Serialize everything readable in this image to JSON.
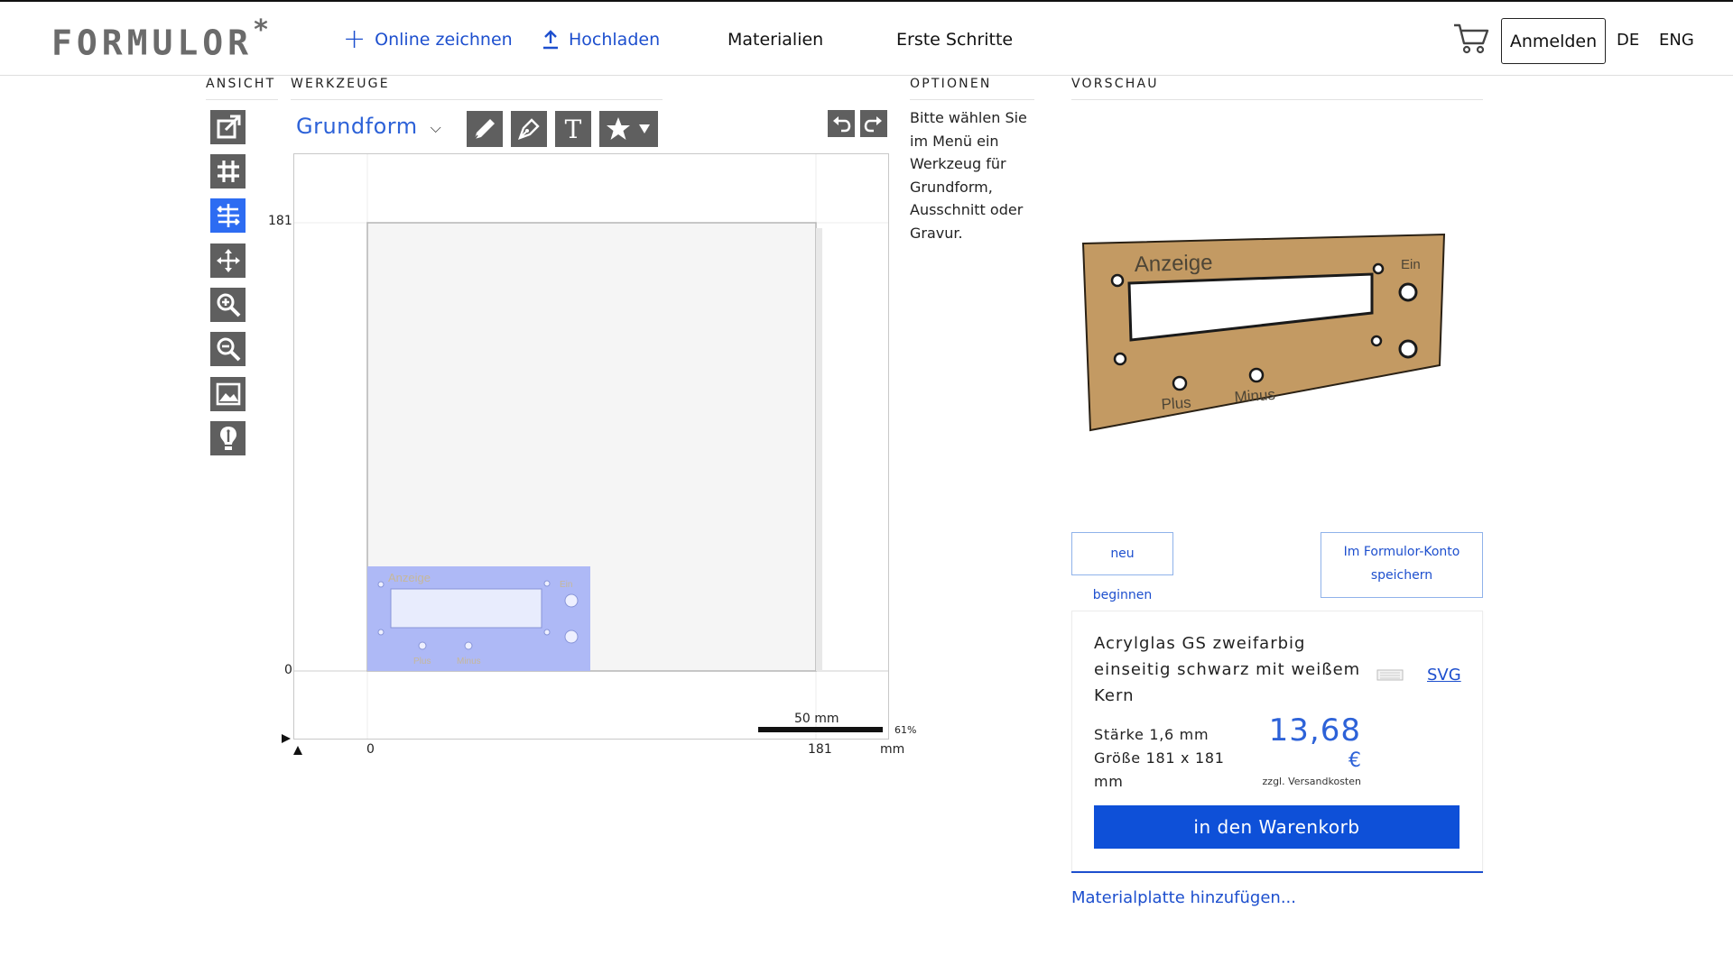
{
  "header": {
    "logo": "FORMULOR",
    "logo_mark": "*",
    "nav_online": "Online zeichnen",
    "nav_upload": "Hochladen",
    "nav_materials": "Materialien",
    "nav_first_steps": "Erste Schritte",
    "login": "Anmelden",
    "lang_de": "DE",
    "lang_en": "ENG"
  },
  "sections": {
    "view": "ANSICHT",
    "tools": "WERKZEUGE",
    "options": "OPTIONEN",
    "preview": "VORSCHAU"
  },
  "view_tools": [
    {
      "icon": "export-icon",
      "active": false
    },
    {
      "icon": "grid-icon",
      "active": false
    },
    {
      "icon": "align-icon",
      "active": true
    },
    {
      "icon": "move-icon",
      "active": false
    },
    {
      "icon": "zoom-in-icon",
      "active": false
    },
    {
      "icon": "zoom-out-icon",
      "active": false
    },
    {
      "icon": "image-icon",
      "active": false
    },
    {
      "icon": "hint-icon",
      "active": false
    }
  ],
  "tools": {
    "shape_select": "Grundform",
    "tool_icons": [
      "pencil-icon",
      "pen-icon",
      "text-icon",
      "star-icon"
    ],
    "text_tool_glyph": "T",
    "undo_icon": "undo-icon",
    "redo_icon": "redo-icon"
  },
  "canvas": {
    "y_max_label": "181",
    "y_zero_label": "0",
    "x_zero_label": "0",
    "x_max_label": "181",
    "unit": "mm",
    "scale_label": "50 mm",
    "zoom_label": "61%",
    "design_labels": {
      "display": "Anzeige",
      "on": "Ein",
      "plus": "Plus",
      "minus": "Minus"
    },
    "colors": {
      "part_fill": "#aeb9f6",
      "window_fill": "#e8ecfd"
    }
  },
  "options": {
    "text": "Bitte wählen Sie im Menü ein Werkzeug für Grundform, Ausschnitt oder Gravur."
  },
  "preview": {
    "labels": {
      "display": "Anzeige",
      "on": "Ein",
      "plus": "Plus",
      "minus": "Minus"
    },
    "panel_color": "#c39a63",
    "restart": "neu beginnen",
    "save": "Im Formulor-Konto speichern"
  },
  "material": {
    "name": "Acrylglas GS zweifarbig einseitig schwarz mit weißem Kern",
    "format_link": "SVG",
    "thickness": "Stärke 1,6 mm",
    "size": "Größe 181 x 181 mm",
    "price": "13,68",
    "currency": "€",
    "shipping": "zzgl. Versandkosten",
    "add_to_cart": "in den Warenkorb",
    "add_plate": "Materialplatte hinzufügen..."
  },
  "theme": {
    "accent": "#1d4fce",
    "active_tool": "#2d6cf2",
    "tool_bg": "#5f5f5f"
  }
}
